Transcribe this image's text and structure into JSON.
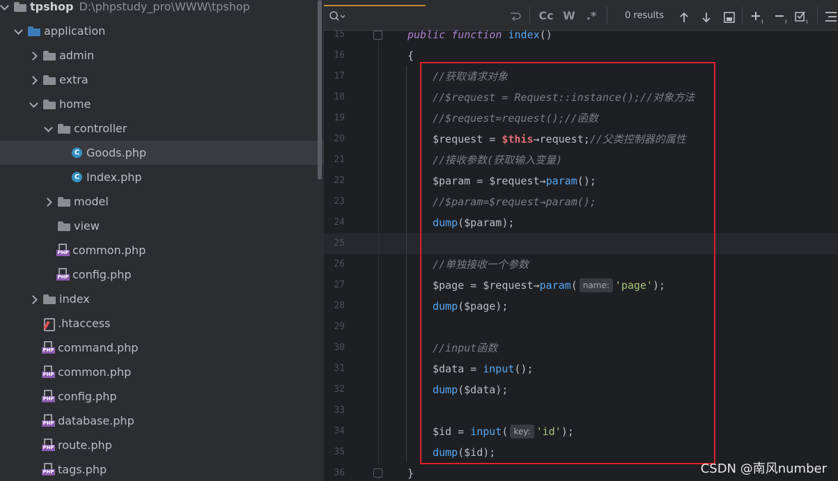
{
  "project_tree": {
    "root": {
      "name": "tpshop",
      "path": "D:\\phpstudy_pro\\WWW\\tpshop"
    },
    "items": [
      {
        "label": "application",
        "icon": "folder-icon",
        "expanded": true
      },
      {
        "label": "admin",
        "icon": "folder-icon",
        "expanded": false
      },
      {
        "label": "extra",
        "icon": "folder-icon",
        "expanded": false
      },
      {
        "label": "home",
        "icon": "folder-icon",
        "expanded": true
      },
      {
        "label": "controller",
        "icon": "folder-icon",
        "expanded": true
      },
      {
        "label": "Goods.php",
        "icon": "php-class-icon",
        "selected": true
      },
      {
        "label": "Index.php",
        "icon": "php-class-icon"
      },
      {
        "label": "model",
        "icon": "folder-icon",
        "expanded": false
      },
      {
        "label": "view",
        "icon": "folder-icon"
      },
      {
        "label": "common.php",
        "icon": "php-file-icon"
      },
      {
        "label": "config.php",
        "icon": "php-file-icon"
      },
      {
        "label": "index",
        "icon": "folder-icon",
        "expanded": false
      },
      {
        "label": ".htaccess",
        "icon": "htaccess-icon"
      },
      {
        "label": "command.php",
        "icon": "php-file-icon"
      },
      {
        "label": "common.php",
        "icon": "php-file-icon"
      },
      {
        "label": "config.php",
        "icon": "php-file-icon"
      },
      {
        "label": "database.php",
        "icon": "php-file-icon"
      },
      {
        "label": "route.php",
        "icon": "php-file-icon"
      },
      {
        "label": "tags.php",
        "icon": "php-file-icon"
      }
    ]
  },
  "find_bar": {
    "results": "0 results",
    "match_case": "Cc",
    "words": "W",
    "regex": ".*"
  },
  "editor": {
    "line_numbers": [
      "15",
      "16",
      "17",
      "18",
      "19",
      "20",
      "21",
      "22",
      "23",
      "24",
      "25",
      "26",
      "27",
      "28",
      "29",
      "30",
      "31",
      "32",
      "33",
      "34",
      "35",
      "36"
    ],
    "lines": [
      {
        "kw1": "public",
        "kw2": "function",
        "fn": "index",
        "rest": "()"
      },
      {
        "text": "{"
      },
      {
        "comment": "//获取请求对象"
      },
      {
        "comment": "//$request = Request::instance();//对象方法"
      },
      {
        "comment": "//$request=request();//函数"
      },
      {
        "var": "$request = ",
        "this": "$this",
        "rest": "→request;",
        "comment": "//父类控制器的属性"
      },
      {
        "comment": "//接收参数(获取输入变量)"
      },
      {
        "var": "$param = $request→",
        "fn": "param",
        "rest": "();"
      },
      {
        "comment": "//$param=$request→param();"
      },
      {
        "fn": "dump",
        "rest": "($param);"
      },
      {
        "text": ""
      },
      {
        "comment": "//单独接收一个参数"
      },
      {
        "var": "$page = $request→",
        "fn": "param",
        "open": "(",
        "hint": "name:",
        "str": "'page'",
        "rest": ");"
      },
      {
        "fn": "dump",
        "rest": "($page);"
      },
      {
        "text": ""
      },
      {
        "comment": "//input函数"
      },
      {
        "var": "$data = ",
        "fn": "input",
        "rest": "();"
      },
      {
        "fn": "dump",
        "rest": "($data);"
      },
      {
        "text": ""
      },
      {
        "var": "$id = ",
        "fn": "input",
        "open": "(",
        "hint": "key:",
        "str": "'id'",
        "rest": ");"
      },
      {
        "fn": "dump",
        "rest": "($id);"
      },
      {
        "text": "}"
      }
    ]
  },
  "colors": {
    "highlight_box": "#e0202a",
    "find_underline": "#c08a2a"
  },
  "watermark": "CSDN @南风number"
}
